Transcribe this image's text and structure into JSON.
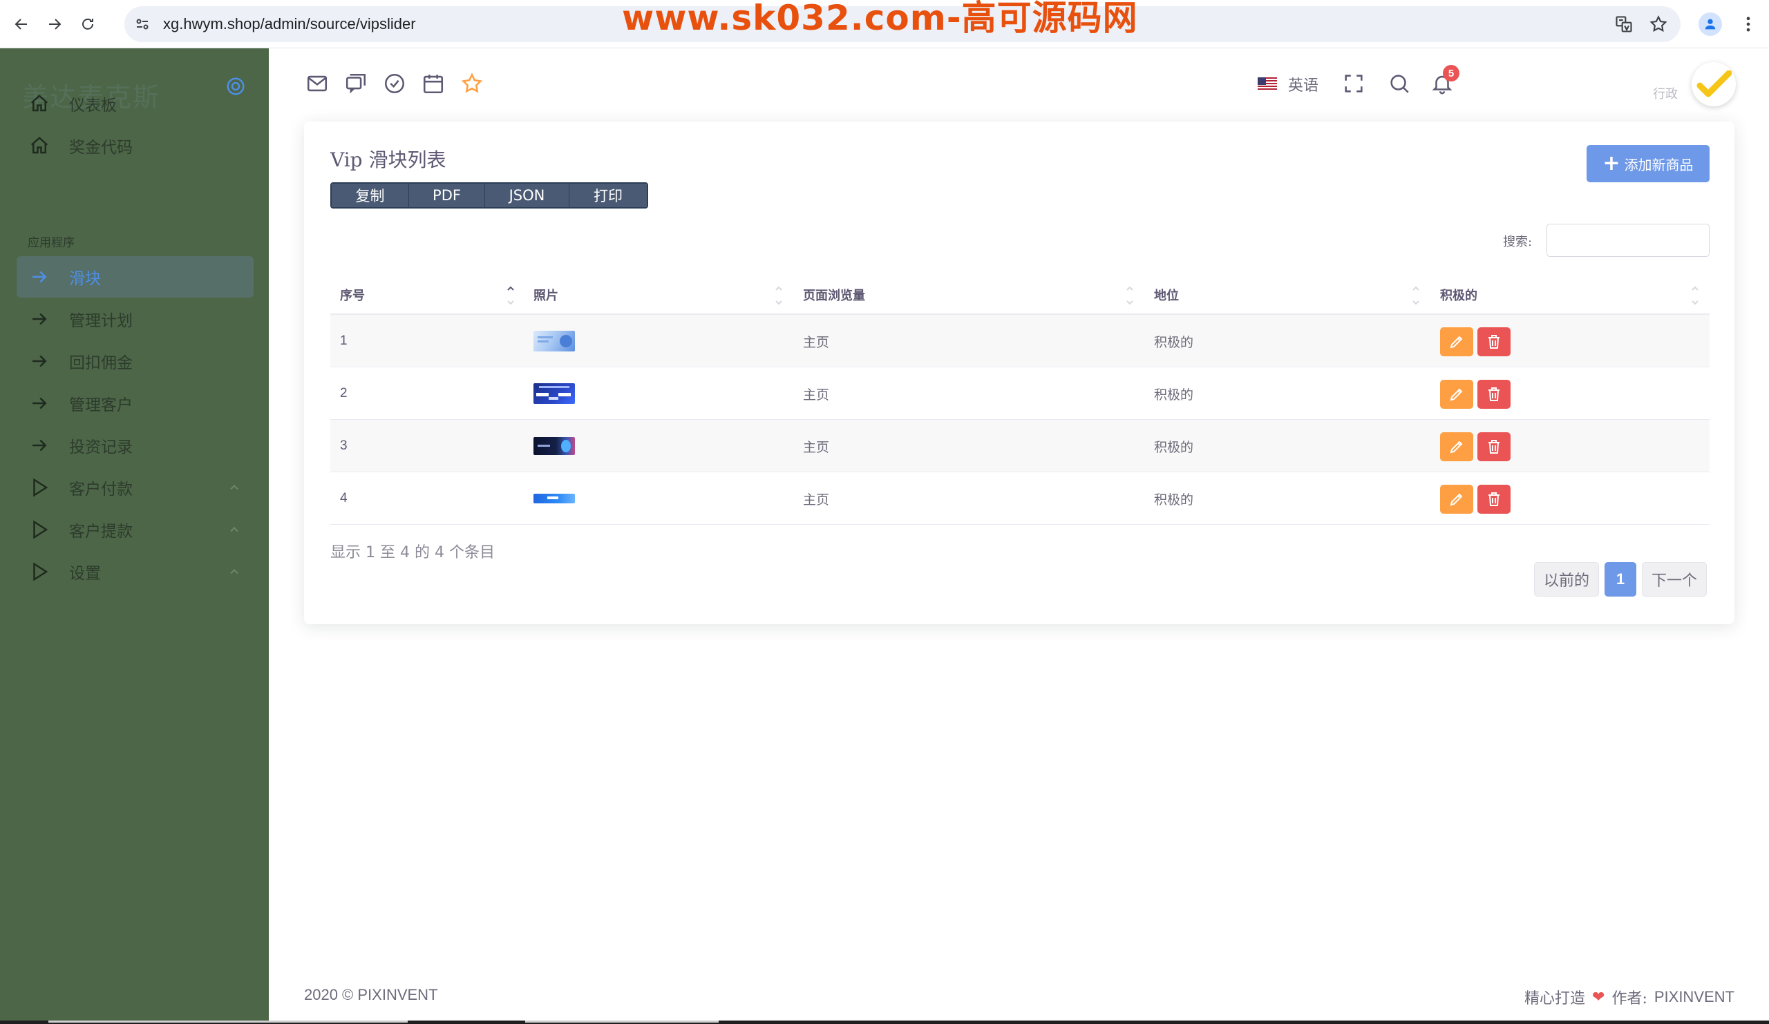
{
  "browser": {
    "url": "xg.hwym.shop/admin/source/vipslider",
    "watermark": "www.sk032.com-高可源码网"
  },
  "sidebar": {
    "brand": "美达麦克斯",
    "section_label": "应用程序",
    "items": [
      {
        "label": "仪表板",
        "icon": "home-icon"
      },
      {
        "label": "奖金代码",
        "icon": "home-icon"
      },
      {
        "label": "滑块",
        "icon": "arrow-right-icon",
        "active": true
      },
      {
        "label": "管理计划",
        "icon": "arrow-right-icon"
      },
      {
        "label": "回扣佣金",
        "icon": "arrow-right-icon"
      },
      {
        "label": "管理客户",
        "icon": "arrow-right-icon"
      },
      {
        "label": "投资记录",
        "icon": "arrow-right-icon"
      },
      {
        "label": "客户付款",
        "icon": "play-icon",
        "expandable": true
      },
      {
        "label": "客户提款",
        "icon": "play-icon",
        "expandable": true
      },
      {
        "label": "设置",
        "icon": "play-icon",
        "expandable": true
      }
    ]
  },
  "header": {
    "language": "英语",
    "notification_count": "5",
    "user_role": "行政"
  },
  "card": {
    "title": "Vip 滑块列表",
    "add_button": "添加新商品",
    "export_buttons": [
      "复制",
      "PDF",
      "JSON",
      "打印"
    ],
    "search_label": "搜索:",
    "search_value": "",
    "columns": [
      "序号",
      "照片",
      "页面浏览量",
      "地位",
      "积极的"
    ],
    "rows": [
      {
        "index": "1",
        "page": "主页",
        "status": "积极的"
      },
      {
        "index": "2",
        "page": "主页",
        "status": "积极的"
      },
      {
        "index": "3",
        "page": "主页",
        "status": "积极的"
      },
      {
        "index": "4",
        "page": "主页",
        "status": "积极的"
      }
    ],
    "info": "显示 1 至 4 的 4 个条目",
    "pager": {
      "prev": "以前的",
      "current": "1",
      "next": "下一个"
    }
  },
  "footer": {
    "left": "2020 © PIXINVENT",
    "made_with": "精心打造",
    "author_label": "作者:",
    "author": "PIXINVENT"
  },
  "colors": {
    "sidebar_bg": "#4d6648",
    "primary": "#6e98e8",
    "edit": "#ff9f43",
    "delete": "#ea5455",
    "watermark": "#e8500e"
  }
}
